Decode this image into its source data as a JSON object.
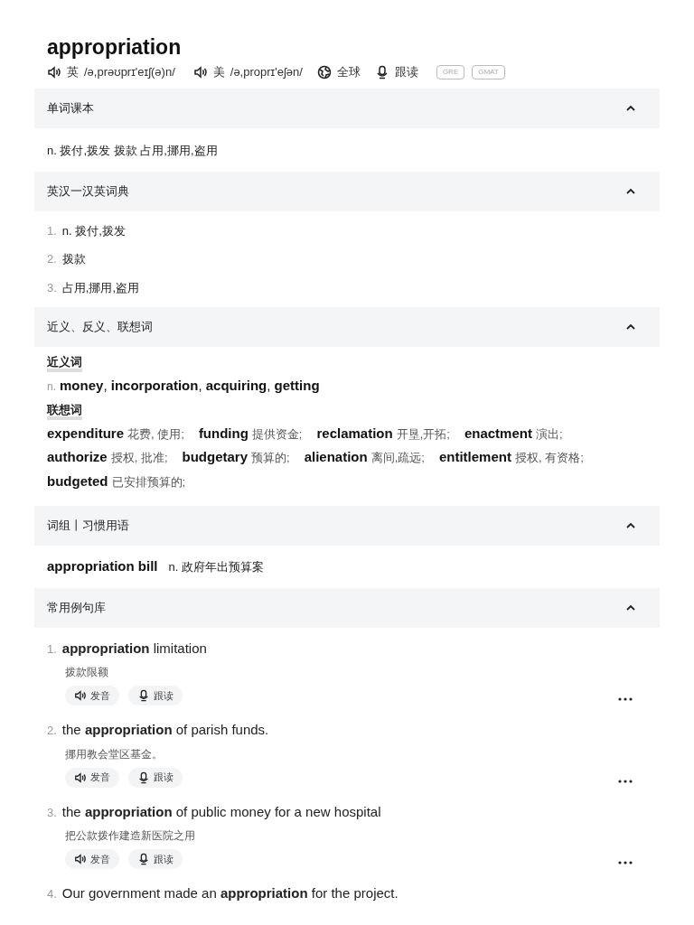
{
  "word": "appropriation",
  "pronunciations": [
    {
      "region": "英",
      "ipa": "/ə,prəʊprɪ'eɪʃ(ə)n/"
    },
    {
      "region": "美",
      "ipa": "/ə,proprɪ'eʃən/"
    }
  ],
  "actions": [
    {
      "kind": "globe",
      "label": "全球"
    },
    {
      "kind": "mic",
      "label": "跟读"
    }
  ],
  "tags": [
    "GRE",
    "GMAT"
  ],
  "sections": [
    {
      "kind": "definition",
      "title": "单词课本",
      "expanded": true,
      "text": "n. 拨付,拨发 拨款 占用,挪用,盗用"
    },
    {
      "kind": "numbered",
      "title": "英汉一汉英词典",
      "expanded": true,
      "items": [
        {
          "number": "1.",
          "text": "n. 拨付,拨发"
        },
        {
          "number": "2.",
          "text": "拨款"
        },
        {
          "number": "3.",
          "text": "占用,挪用,盗用"
        }
      ]
    },
    {
      "kind": "related",
      "title": "近义、反义、联想词",
      "expanded": true,
      "groups": [
        {
          "heading": "近义词",
          "pos": "n.",
          "words": "**money**, **incorporation**, **acquiring**, **getting**"
        },
        {
          "heading": "联想词",
          "entries": [
            {
              "word": "expenditure",
              "meaning": "花费, 使用;"
            },
            {
              "word": "funding",
              "meaning": "提供资金;"
            },
            {
              "word": "reclamation",
              "meaning": "开垦,开拓;"
            },
            {
              "word": "enactment",
              "meaning": "演出;"
            },
            {
              "word": "authorize",
              "meaning": "授权, 批准;"
            },
            {
              "word": "budgetary",
              "meaning": "预算的;"
            },
            {
              "word": "alienation",
              "meaning": "离间,疏远;"
            },
            {
              "word": "entitlement",
              "meaning": "授权, 有资格;"
            },
            {
              "word": "budgeted",
              "meaning": "已安排预算的;"
            }
          ]
        }
      ]
    },
    {
      "kind": "phrases",
      "title": "词组丨习惯用语",
      "expanded": true,
      "items": [
        {
          "phrase": "appropriation bill",
          "meaning": "n. 政府年出预算案"
        }
      ]
    },
    {
      "kind": "examples",
      "title": "常用例句库",
      "expanded": true,
      "items": [
        {
          "number": "1.",
          "sentence": "**appropriation** limitation",
          "translation": "拨款限额",
          "buttons": [
            "发音",
            "跟读"
          ]
        },
        {
          "number": "2.",
          "sentence": "the **appropriation** of parish funds.",
          "translation": "挪用教会堂区基金。",
          "buttons": [
            "发音",
            "跟读"
          ]
        },
        {
          "number": "3.",
          "sentence": "the **appropriation** of public money for a new hospital",
          "translation": "把公款拨作建造新医院之用",
          "buttons": [
            "发音",
            "跟读"
          ]
        },
        {
          "number": "4.",
          "sentence": "Our government made an **appropriation** for the project."
        }
      ]
    }
  ]
}
